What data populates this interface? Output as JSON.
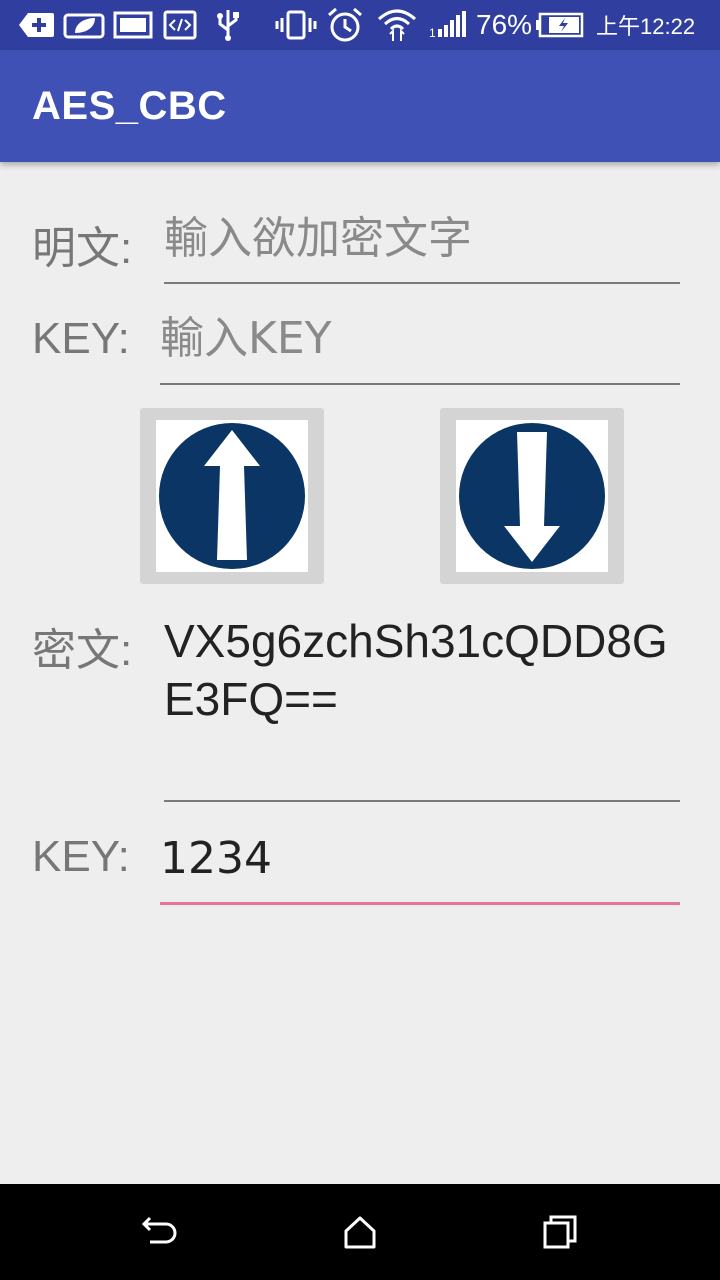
{
  "status_bar": {
    "battery_percent": "76%",
    "time": "上午12:22",
    "icons": [
      "add-notification-icon",
      "leaf-icon",
      "image-icon",
      "code-icon",
      "usb-icon",
      "vibrate-icon",
      "alarm-icon",
      "wifi-icon",
      "signal-icon",
      "battery-charging-icon"
    ]
  },
  "app_bar": {
    "title": "AES_CBC"
  },
  "plaintext": {
    "label": "明文:",
    "value": "",
    "placeholder": "輸入欲加密文字"
  },
  "encrypt_key": {
    "label": "KEY:",
    "value": "",
    "placeholder": "輸入KEY"
  },
  "buttons": {
    "encrypt_icon": "arrow-up-icon",
    "decrypt_icon": "arrow-down-icon"
  },
  "ciphertext": {
    "label": "密文:",
    "value": "VX5g6zchSh31cQDD8GE3FQ=="
  },
  "decrypt_key": {
    "label": "KEY:",
    "value": "1234"
  },
  "colors": {
    "status_bar": "#303f9f",
    "app_bar": "#3f51b5",
    "background": "#eeeeee",
    "focus_accent": "#e57399",
    "button_circle": "#0a3565"
  },
  "nav_bar": {
    "icons": [
      "back-icon",
      "home-icon",
      "recents-icon"
    ]
  }
}
